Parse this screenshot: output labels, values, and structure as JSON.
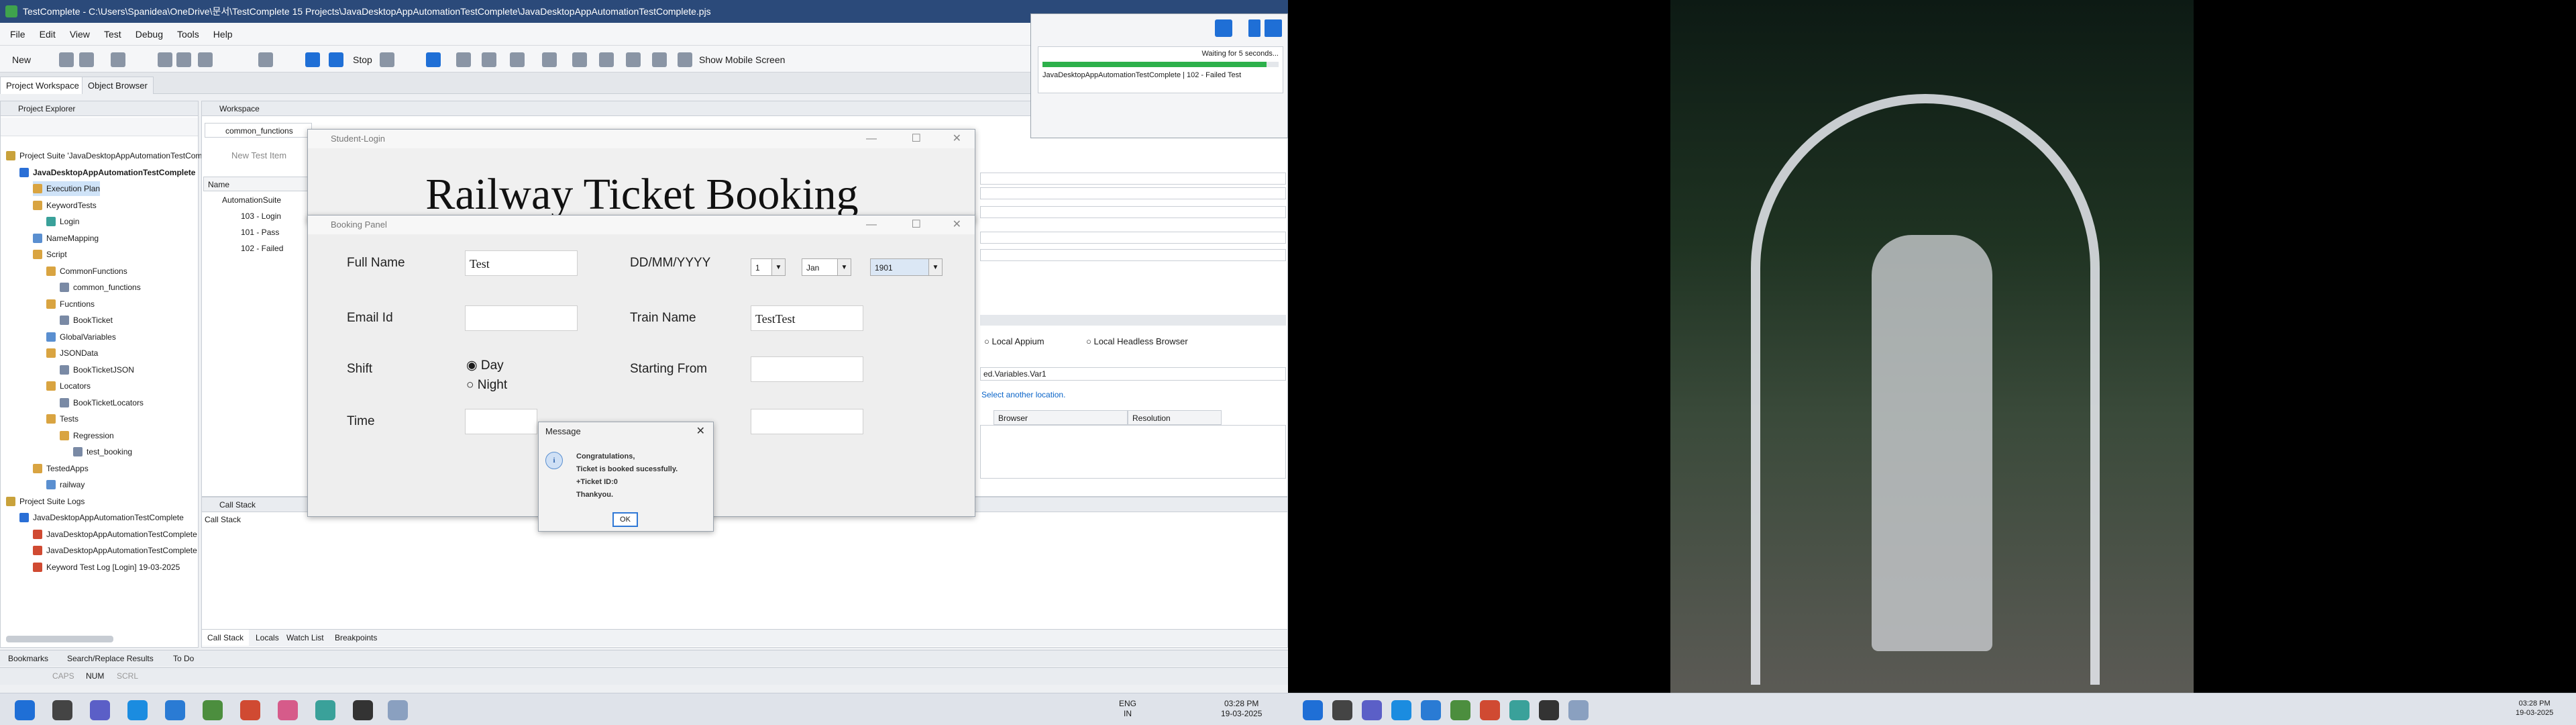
{
  "app": {
    "title": "TestComplete - C:\\Users\\Spanidea\\OneDrive\\문서\\TestComplete 15 Projects\\JavaDesktopAppAutomationTestComplete\\JavaDesktopAppAutomationTestComplete.pjs",
    "menu": [
      "File",
      "Edit",
      "View",
      "Test",
      "Debug",
      "Tools",
      "Help"
    ],
    "toolbar": {
      "new_label": "New",
      "stop_label": "Stop",
      "show_mobile_label": "Show Mobile Screen"
    },
    "workspace_tabs": [
      "Project Workspace",
      "Object Browser"
    ]
  },
  "project_explorer": {
    "title": "Project Explorer",
    "items": [
      "Project Suite 'JavaDesktopAppAutomationTestComplete'",
      "JavaDesktopAppAutomationTestComplete",
      "Execution Plan",
      "KeywordTests",
      "Login",
      "NameMapping",
      "Script",
      "CommonFunctions",
      "common_functions",
      "Fucntions",
      "BookTicket",
      "GlobalVariables",
      "JSONData",
      "BookTicketJSON",
      "Locators",
      "BookTicketLocators",
      "Tests",
      "Regression",
      "test_booking",
      "TestedApps",
      "railway",
      "Project Suite Logs",
      "JavaDesktopAppAutomationTestComplete",
      "JavaDesktopAppAutomationTestComplete",
      "JavaDesktopAppAutomationTestComplete",
      "Keyword Test Log [Login] 19-03-2025"
    ]
  },
  "workspace": {
    "title": "Workspace",
    "tab": "common_functions",
    "new_test_item": "New Test Item",
    "grid_header": "Name",
    "suite_row": "AutomationSuite",
    "test_rows": [
      "103 - Login",
      "101 - Pass",
      "102 - Failed"
    ]
  },
  "run_settings": {
    "local_appium": "Local Appium",
    "local_headless": "Local Headless Browser",
    "variables_value": "ed.Variables.Var1",
    "select_location": "Select another location.",
    "col_browser": "Browser",
    "col_resolution": "Resolution"
  },
  "progress": {
    "waiting": "Waiting for 5 seconds...",
    "status": "JavaDesktopAppAutomationTestComplete | 102 - Failed Test",
    "fraction": 0.95
  },
  "student_login": {
    "title": "Student-Login",
    "heading": "Railway Ticket Booking"
  },
  "booking_panel": {
    "title": "Booking Panel",
    "full_name_label": "Full Name",
    "full_name_value": "Test",
    "dob_label": "DD/MM/YYYY",
    "day_value": "1",
    "month_value": "Jan",
    "year_value": "1901",
    "email_label": "Email Id",
    "email_value": "",
    "train_name_label": "Train Name",
    "train_name_value": "TestTest",
    "shift_label": "Shift",
    "shift_day": "Day",
    "shift_night": "Night",
    "starting_from_label": "Starting From",
    "time_label": "Time"
  },
  "message_dialog": {
    "title": "Message",
    "lines": [
      "Congratulations,",
      "Ticket is booked sucessfully.",
      "+Ticket ID:0",
      "Thankyou."
    ],
    "ok_label": "OK"
  },
  "call_stack": {
    "panel_title": "Call Stack",
    "grid_header": "Call Stack",
    "bottom_tabs": [
      "Call Stack",
      "Locals",
      "Watch List",
      "Breakpoints"
    ]
  },
  "bottom_bar": {
    "tabs": [
      "Bookmarks",
      "Search/Replace Results",
      "To Do"
    ],
    "indicators": [
      "CAPS",
      "NUM",
      "SCRL"
    ]
  },
  "taskbar_left": {
    "lang": "ENG",
    "region": "IN",
    "time": "03:28 PM",
    "date": "19-03-2025"
  },
  "taskbar_right": {
    "time": "03:28 PM",
    "date": "19-03-2025"
  },
  "colors": {
    "titlebar": "#2b4a7a",
    "accent": "#0a64c8",
    "progress_green": "#2db04b"
  }
}
